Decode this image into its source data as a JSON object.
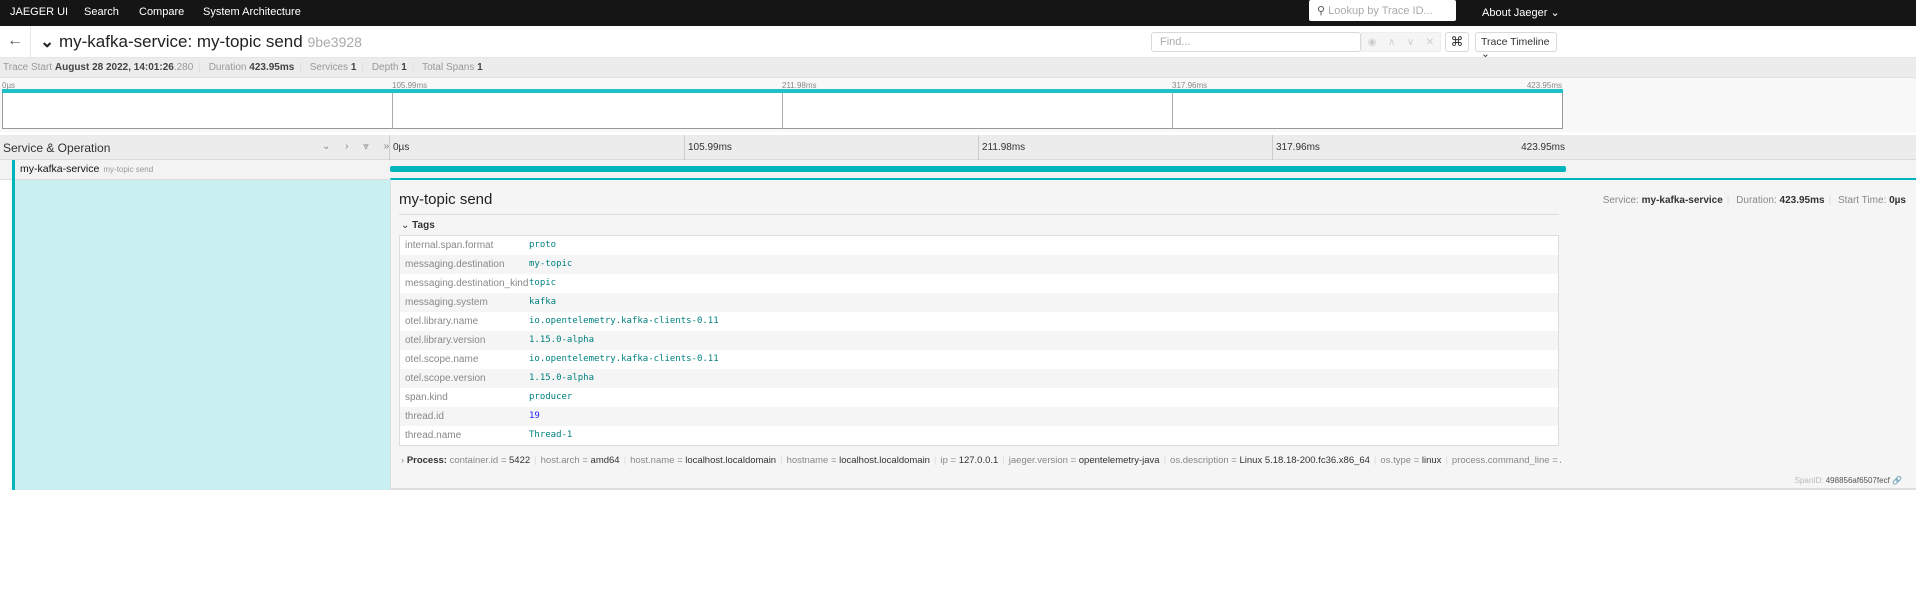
{
  "nav": {
    "brand": "JAEGER UI",
    "items": [
      "Search",
      "Compare",
      "System Architecture"
    ],
    "lookup_placeholder": "Lookup by Trace ID...",
    "about": "About Jaeger ⌄"
  },
  "header": {
    "back_icon": "←",
    "collapse_icon": "⌄",
    "title": "my-kafka-service: my-topic send",
    "trace_id": "9be3928",
    "find_placeholder": "Find...",
    "find_buttons": [
      "◉",
      "∧",
      "∨",
      "✕"
    ],
    "shortcut_icon": "⌘",
    "view_select": "Trace Timeline ⌄"
  },
  "info": {
    "trace_start_label": "Trace Start",
    "trace_start": "August 28 2022, 14:01:26",
    "trace_start_ms": ".280",
    "duration_label": "Duration",
    "duration": "423.95ms",
    "services_label": "Services",
    "services": "1",
    "depth_label": "Depth",
    "depth": "1",
    "total_spans_label": "Total Spans",
    "total_spans": "1"
  },
  "ticks": [
    "0µs",
    "105.99ms",
    "211.98ms",
    "317.96ms",
    "423.95ms"
  ],
  "timeline": {
    "header": "Service & Operation",
    "controls": "⌄ › ⩔ »",
    "service": "my-kafka-service",
    "operation": "my-topic send",
    "span_fraction": 1.0
  },
  "colors": {
    "accent": "#00b5bc"
  },
  "detail": {
    "title": "my-topic send",
    "service_label": "Service:",
    "service": "my-kafka-service",
    "duration_label": "Duration:",
    "duration": "423.95ms",
    "start_label": "Start Time:",
    "start": "0µs",
    "tags_label": "Tags",
    "tags": [
      [
        "internal.span.format",
        "proto"
      ],
      [
        "messaging.destination",
        "my-topic"
      ],
      [
        "messaging.destination_kind",
        "topic"
      ],
      [
        "messaging.system",
        "kafka"
      ],
      [
        "otel.library.name",
        "io.opentelemetry.kafka-clients-0.11"
      ],
      [
        "otel.library.version",
        "1.15.0-alpha"
      ],
      [
        "otel.scope.name",
        "io.opentelemetry.kafka-clients-0.11"
      ],
      [
        "otel.scope.version",
        "1.15.0-alpha"
      ],
      [
        "span.kind",
        "producer"
      ],
      [
        "thread.id",
        "19"
      ],
      [
        "thread.name",
        "Thread-1"
      ]
    ],
    "process_label": "Process:",
    "process": [
      [
        "container.id",
        "5422"
      ],
      [
        "host.arch",
        "amd64"
      ],
      [
        "host.name",
        "localhost.localdomain"
      ],
      [
        "hostname",
        "localhost.localdomain"
      ],
      [
        "ip",
        "127.0.0.1"
      ],
      [
        "jaeger.version",
        "opentelemetry-java"
      ],
      [
        "os.description",
        "Linux 5.18.18-200.fc36.x86_64"
      ],
      [
        "os.type",
        "linux"
      ],
      [
        "process.command_line",
        "/usr..."
      ]
    ],
    "span_id_label": "SpanID:",
    "span_id": "498856af6507fecf"
  }
}
